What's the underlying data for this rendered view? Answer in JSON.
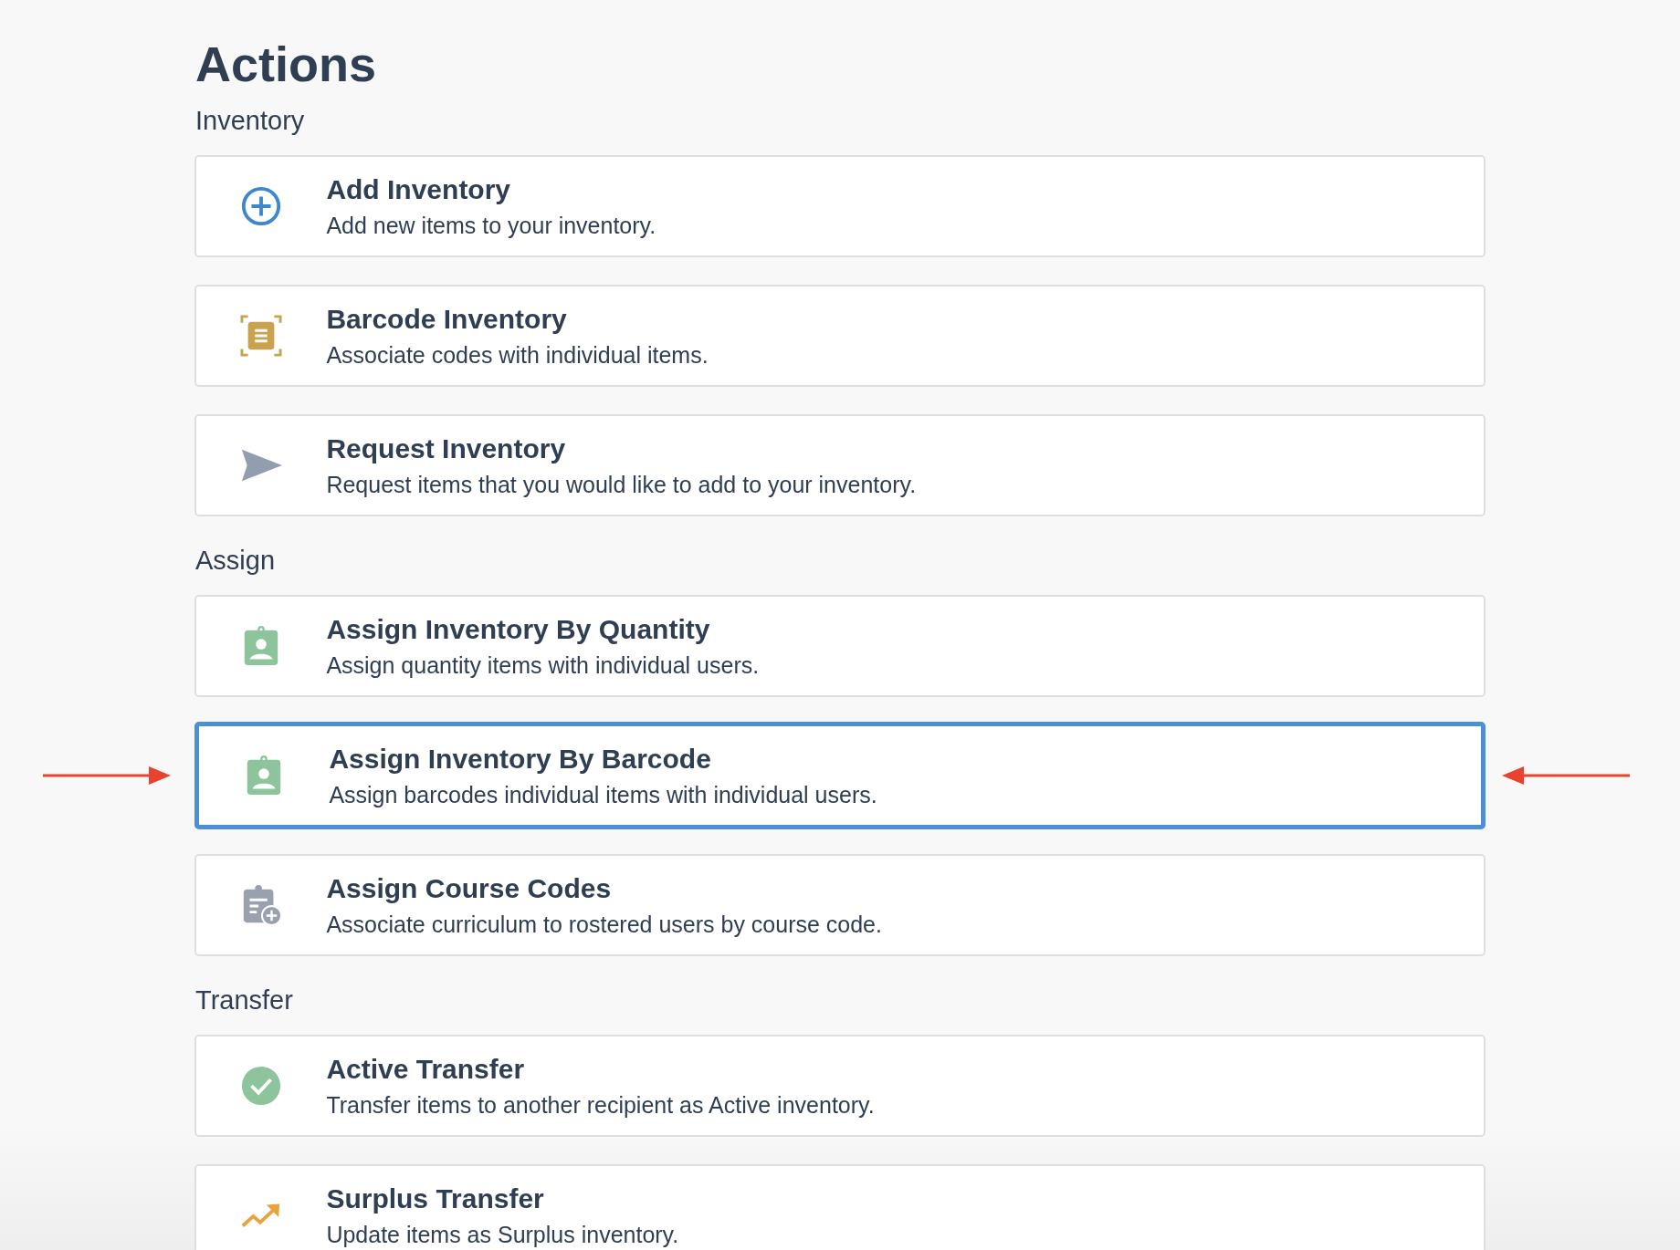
{
  "title": "Actions",
  "sections": [
    {
      "label": "Inventory",
      "items": [
        {
          "kind": "add",
          "title": "Add Inventory",
          "description": "Add new items to your inventory.",
          "selected": false
        },
        {
          "kind": "scan",
          "title": "Barcode Inventory",
          "description": "Associate codes with individual items.",
          "selected": false
        },
        {
          "kind": "send",
          "title": "Request Inventory",
          "description": "Request items that you would like to add to your inventory.",
          "selected": false
        }
      ]
    },
    {
      "label": "Assign",
      "items": [
        {
          "kind": "badge",
          "title": "Assign Inventory By Quantity",
          "description": "Assign quantity items with individual users.",
          "selected": false
        },
        {
          "kind": "badge",
          "title": "Assign Inventory By Barcode",
          "description": "Assign barcodes individual items with individual users.",
          "selected": true
        },
        {
          "kind": "clipboard",
          "title": "Assign Course Codes",
          "description": "Associate curriculum to rostered users by course code.",
          "selected": false
        }
      ]
    },
    {
      "label": "Transfer",
      "items": [
        {
          "kind": "check",
          "title": "Active Transfer",
          "description": "Transfer items to another recipient as Active inventory.",
          "selected": false
        },
        {
          "kind": "trend",
          "title": "Surplus Transfer",
          "description": "Update items as Surplus inventory.",
          "selected": false
        }
      ]
    }
  ]
}
